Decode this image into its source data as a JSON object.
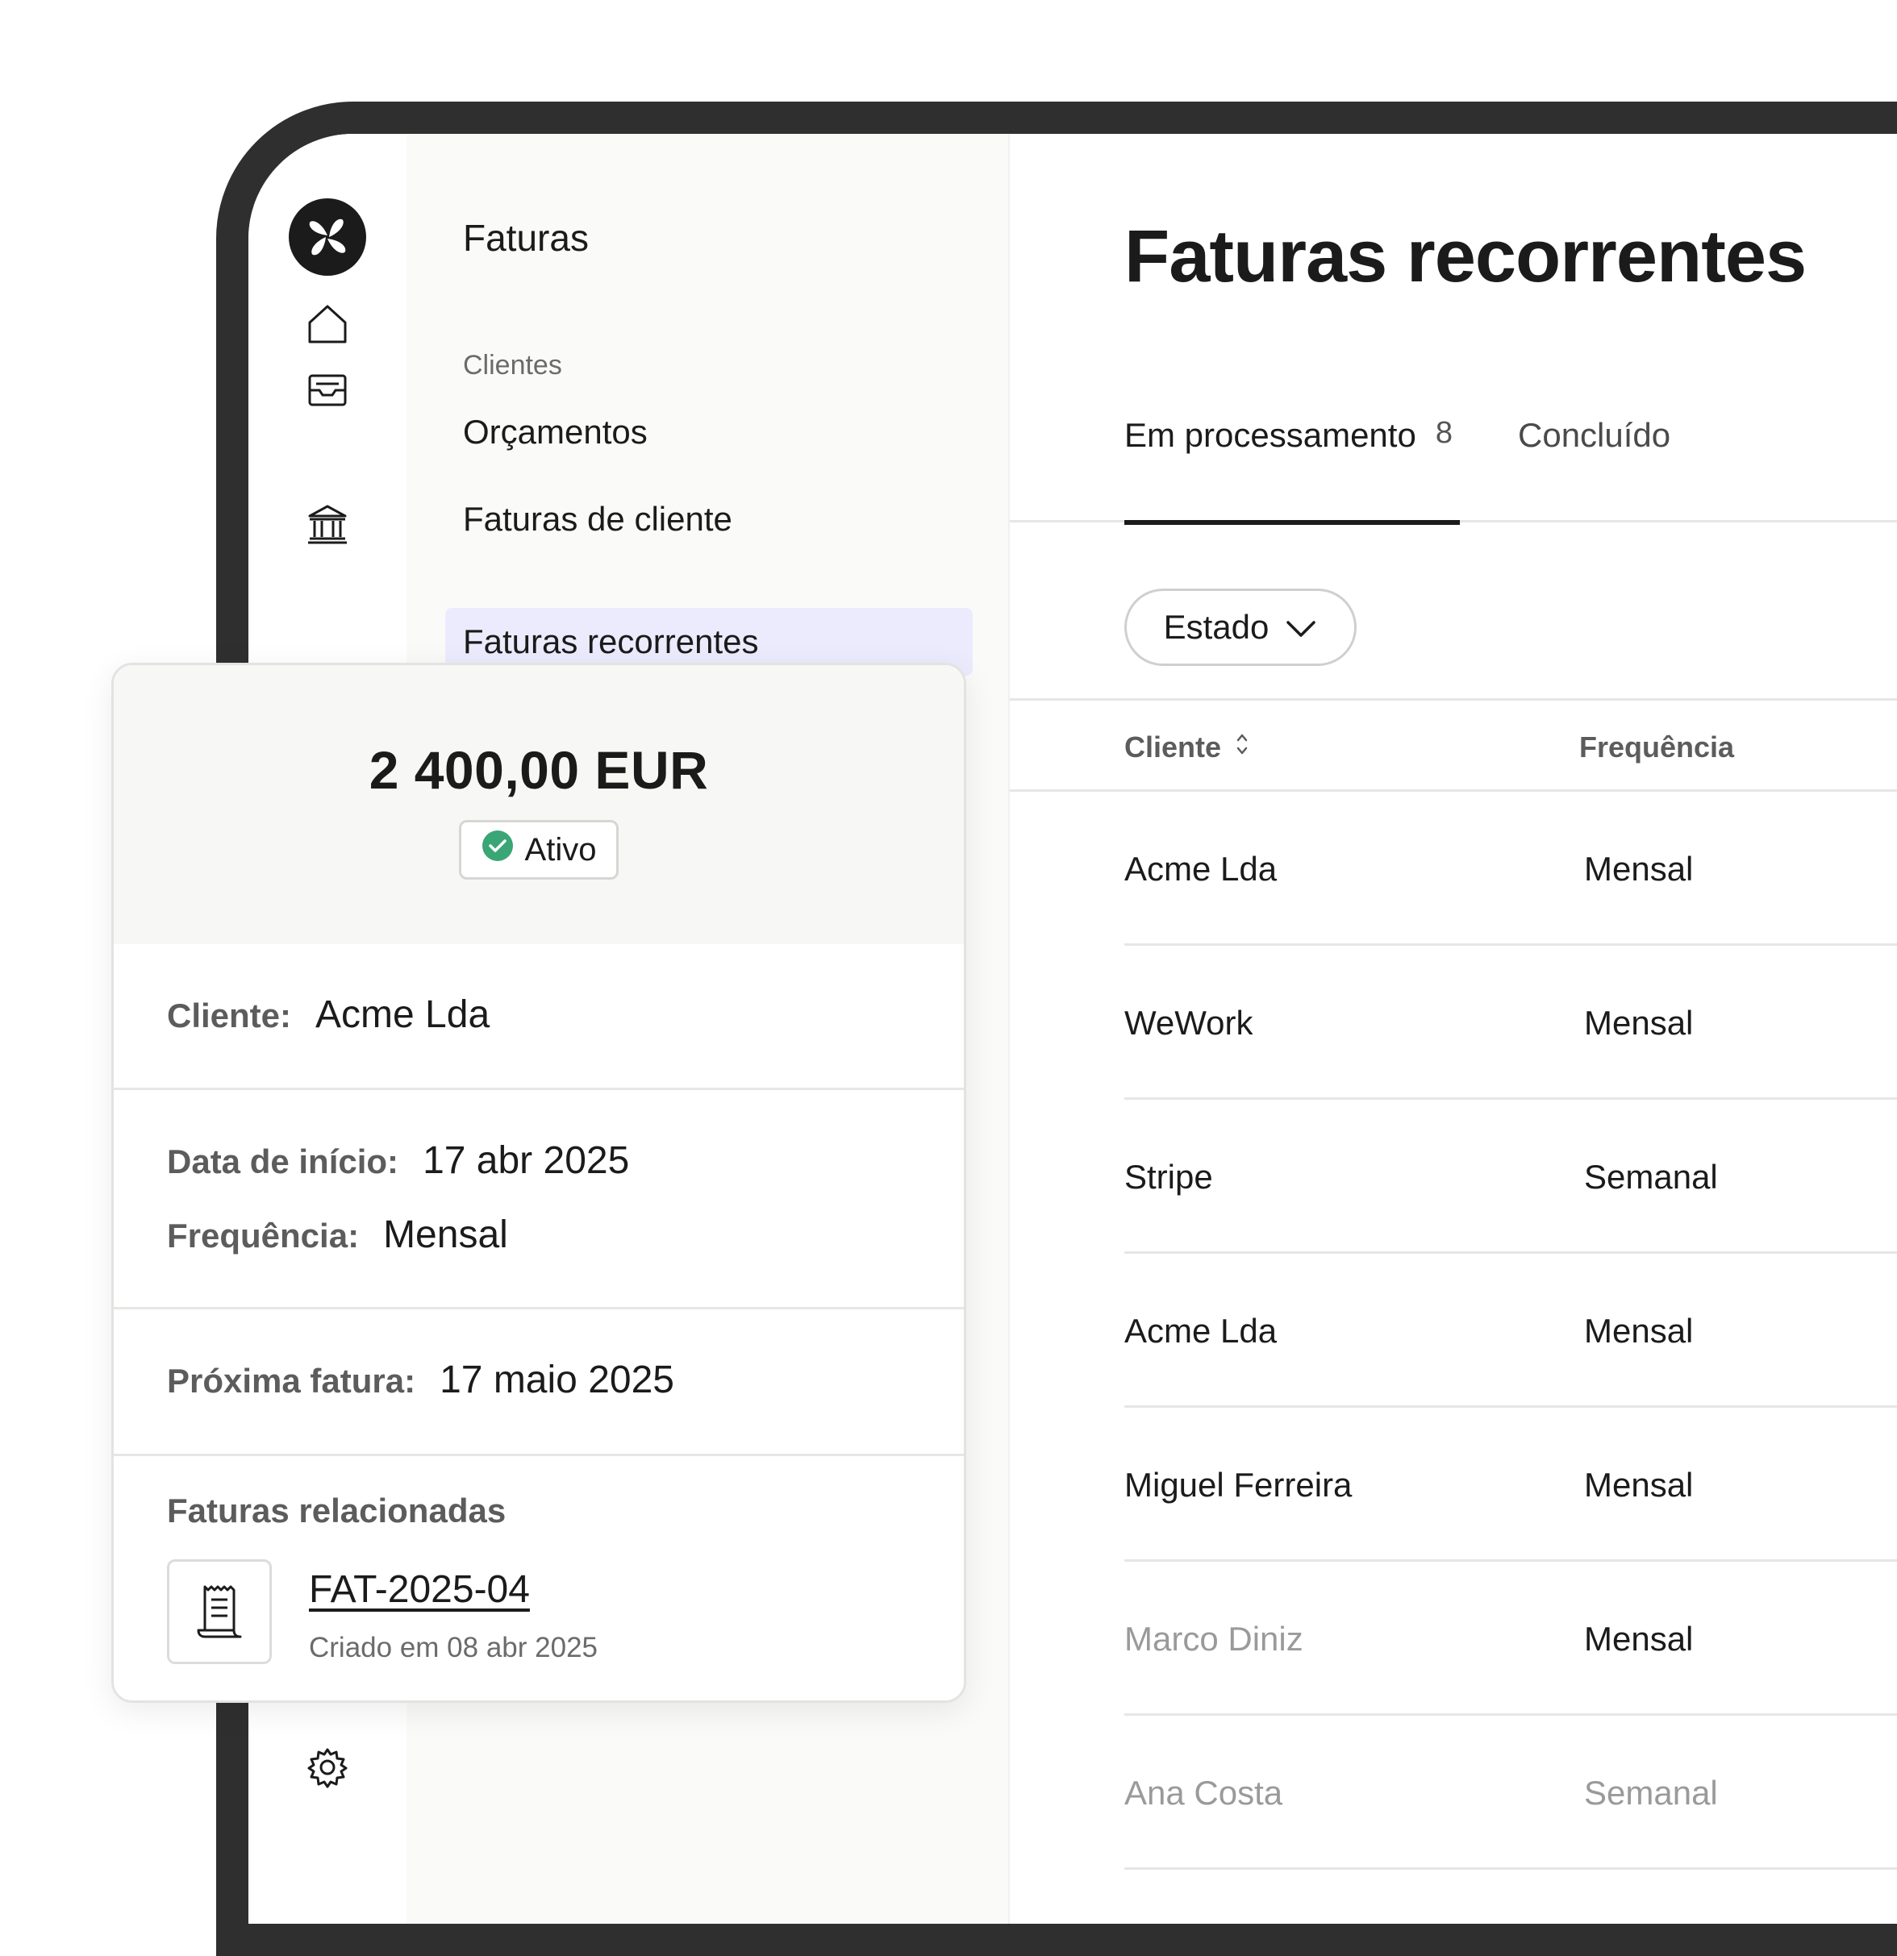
{
  "subnav": {
    "title": "Faturas",
    "section_label": "Clientes",
    "items": [
      {
        "label": "Orçamentos"
      },
      {
        "label": "Faturas de cliente"
      },
      {
        "label": "Faturas recorrentes"
      }
    ]
  },
  "main": {
    "title": "Faturas recorrentes",
    "tabs": [
      {
        "label": "Em processamento",
        "count": "8"
      },
      {
        "label": "Concluído"
      }
    ],
    "filter_label": "Estado",
    "columns": {
      "client": "Cliente",
      "frequency": "Frequência"
    },
    "rows": [
      {
        "client": "Acme Lda",
        "frequency": "Mensal"
      },
      {
        "client": "WeWork",
        "frequency": "Mensal"
      },
      {
        "client": "Stripe",
        "frequency": "Semanal"
      },
      {
        "client": "Acme Lda",
        "frequency": "Mensal"
      },
      {
        "client": "Miguel Ferreira",
        "frequency": "Mensal"
      },
      {
        "client": "Marco Diniz",
        "frequency": "Mensal"
      },
      {
        "client": "Ana Costa",
        "frequency": "Semanal"
      }
    ]
  },
  "card": {
    "amount": "2 400,00 EUR",
    "status": "Ativo",
    "client_label": "Cliente:",
    "client_value": "Acme Lda",
    "start_label": "Data de início:",
    "start_value": "17 abr 2025",
    "freq_label": "Frequência:",
    "freq_value": "Mensal",
    "next_label": "Próxima fatura:",
    "next_value": "17 maio 2025",
    "related_title": "Faturas relacionadas",
    "related_invoice": "FAT-2025-04",
    "related_created": "Criado em 08 abr 2025"
  },
  "colors": {
    "active_nav_bg": "#ecebfd",
    "status_green": "#3aa675",
    "text": "#1b1b1b"
  }
}
